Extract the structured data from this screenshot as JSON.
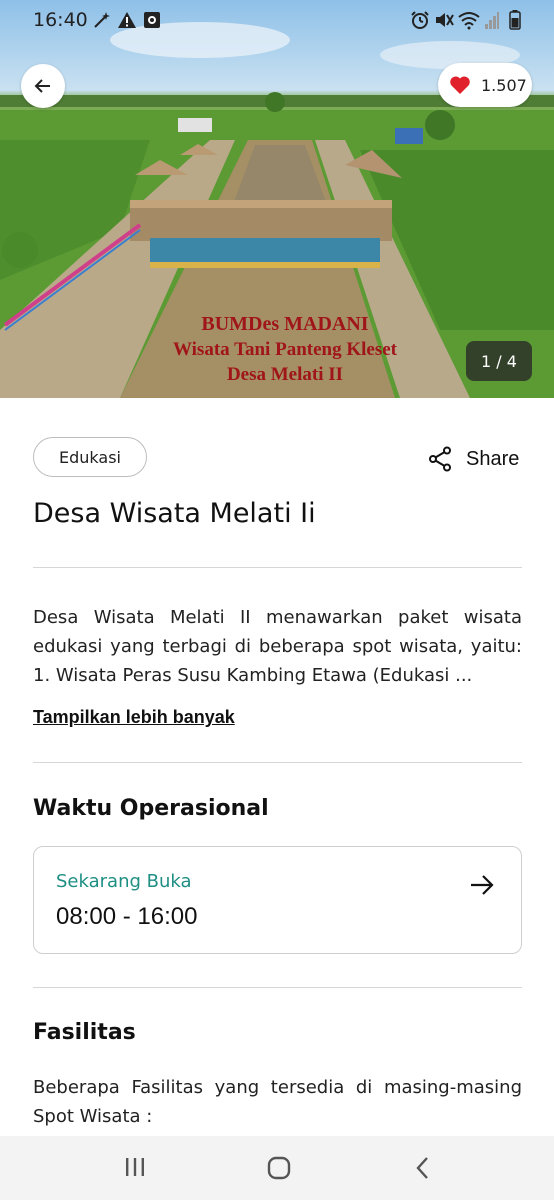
{
  "status_bar": {
    "time": "16:40",
    "icons": [
      "magic-wand-icon",
      "warning-icon",
      "media-icon",
      "alarm-icon",
      "mute-icon",
      "wifi-icon",
      "signal-icon",
      "battery-icon"
    ]
  },
  "hero": {
    "like_count": "1.507",
    "image_counter": "1 / 4",
    "photo_caption": [
      "BUMDes MADANI",
      "Wisata Tani Panteng Kleset",
      "Desa Melati II"
    ],
    "heart_color": "#e0202a"
  },
  "category_chip": "Edukasi",
  "share_label": "Share",
  "title": "Desa Wisata Melati Ii",
  "description": "Desa Wisata Melati II menawarkan paket wisata edukasi yang terbagi di beberapa spot wisata, yaitu: 1. Wisata Peras Susu Kambing Etawa (Edukasi ...",
  "show_more_label": "Tampilkan lebih banyak",
  "operating_hours": {
    "heading": "Waktu Operasional",
    "status": "Sekarang Buka",
    "hours": "08:00 - 16:00",
    "status_color": "#1f8f84"
  },
  "facilities": {
    "heading": "Fasilitas",
    "text": "Beberapa Fasilitas yang tersedia di masing-masing Spot Wisata :"
  },
  "nav_bar": {
    "buttons": [
      "recents-icon",
      "home-icon",
      "back-icon"
    ]
  }
}
